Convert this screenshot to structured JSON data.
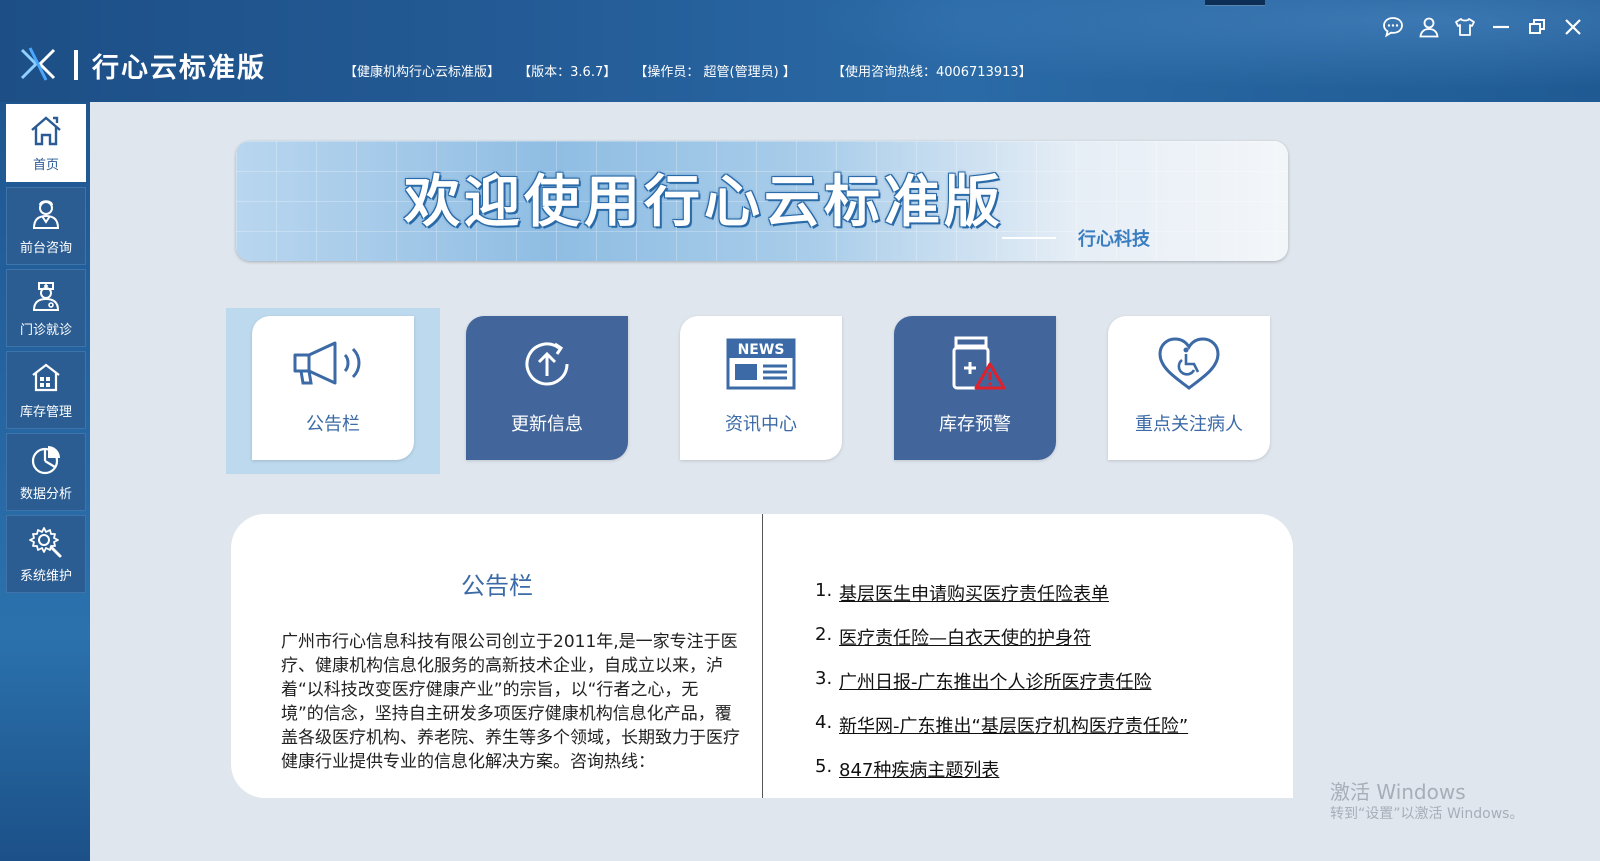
{
  "header": {
    "app_title": "行心云标准版",
    "info": {
      "product": "【健康机构行心云标准版】",
      "version": "【版本：3.6.7】",
      "operator": "【操作员： 超管(管理员) 】",
      "hotline": "【使用咨询热线：4006713913】"
    },
    "controls": [
      "chat-icon",
      "user-icon",
      "skin-icon",
      "minimize-icon",
      "restore-icon",
      "close-icon"
    ]
  },
  "sidebar": {
    "items": [
      {
        "label": "首页",
        "icon": "home-icon",
        "active": true
      },
      {
        "label": "前台咨询",
        "icon": "receptionist-icon",
        "active": false
      },
      {
        "label": "门诊就诊",
        "icon": "doctor-icon",
        "active": false
      },
      {
        "label": "库存管理",
        "icon": "warehouse-icon",
        "active": false
      },
      {
        "label": "数据分析",
        "icon": "pie-chart-icon",
        "active": false
      },
      {
        "label": "系统维护",
        "icon": "settings-icon",
        "active": false
      }
    ]
  },
  "banner": {
    "title": "欢迎使用行心云标准版",
    "subtitle": "行心科技"
  },
  "tiles": [
    {
      "label": "公告栏",
      "icon": "megaphone-icon"
    },
    {
      "label": "更新信息",
      "icon": "update-icon"
    },
    {
      "label": "资讯中心",
      "icon": "news-icon"
    },
    {
      "label": "库存预警",
      "icon": "inventory-warning-icon"
    },
    {
      "label": "重点关注病人",
      "icon": "heart-care-icon"
    }
  ],
  "tile_icon_text": {
    "news": "NEWS"
  },
  "notice": {
    "title": "公告栏",
    "body": "广州市行心信息科技有限公司创立于2011年,是一家专注于医疗、健康机构信息化服务的高新技术企业，自成立以来，泸着“以科技改变医疗健康产业”的宗旨，以“行者之心，无境”的信念，坚持自主研发多项医疗健康机构信息化产品，覆盖各级医疗机构、养老院、养生等多个领域，长期致力于医疗健康行业提供专业的信息化解决方案。咨询热线："
  },
  "news": [
    {
      "num": "1.",
      "title": "基层医生申请购买医疗责任险表单"
    },
    {
      "num": "2.",
      "title": "医疗责任险—白衣天使的护身符"
    },
    {
      "num": "3.",
      "title": "广州日报-广东推出个人诊所医疗责任险"
    },
    {
      "num": "4.",
      "title": "新华网-广东推出“基层医疗机构医疗责任险”"
    },
    {
      "num": "5.",
      "title": "847种疾病主题列表"
    }
  ],
  "watermark": {
    "line1": "激活 Windows",
    "line2": "转到“设置”以激活 Windows。"
  },
  "colors": {
    "brand_blue": "#2a5b95",
    "tile_dark": "#42669c",
    "accent_text": "#3b6aa6",
    "warning_red": "#e0202a"
  }
}
